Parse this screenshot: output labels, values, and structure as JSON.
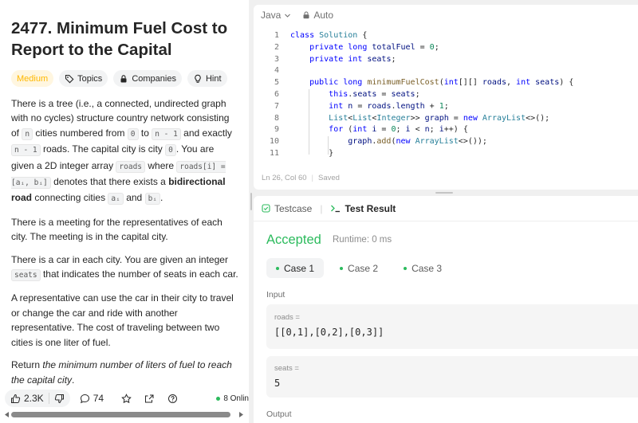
{
  "problem": {
    "title": "2477. Minimum Fuel Cost to Report to the Capital",
    "tags": {
      "difficulty": "Medium",
      "topics": "Topics",
      "companies": "Companies",
      "hint": "Hint"
    },
    "p1": {
      "t1": "There is a tree (i.e., a connected, undirected graph with no cycles) structure country network consisting of ",
      "c1": "n",
      "t2": " cities numbered from ",
      "c2": "0",
      "t3": " to ",
      "c3": "n - 1",
      "t4": " and exactly ",
      "c4": "n - 1",
      "t5": " roads. The capital city is city ",
      "c5": "0",
      "t6": ". You are given a 2D integer array ",
      "c6": "roads",
      "t7": " where ",
      "c7": "roads[i] = [aᵢ, bᵢ]",
      "t8": " denotes that there exists a ",
      "b1": "bidirectional road",
      "t9": " connecting cities ",
      "c8": "aᵢ",
      "t10": " and ",
      "c9": "bᵢ",
      "t11": "."
    },
    "p2": "There is a meeting for the representatives of each city. The meeting is in the capital city.",
    "p3": {
      "t1": "There is a car in each city. You are given an integer ",
      "c1": "seats",
      "t2": " that indicates the number of seats in each car."
    },
    "p4": "A representative can use the car in their city to travel or change the car and ride with another representative. The cost of traveling between two cities is one liter of fuel.",
    "p5": {
      "t1": "Return ",
      "i1": "the minimum number of liters of fuel to reach the capital city",
      "t2": "."
    },
    "bottom": {
      "likes": "2.3K",
      "comments": "74",
      "online": "8 Onlin"
    }
  },
  "editor": {
    "language": "Java",
    "mode": "Auto",
    "status": {
      "position": "Ln 26, Col 60",
      "saved": "Saved"
    },
    "line_numbers": [
      "1",
      "2",
      "3",
      "4",
      "5",
      "6",
      "7",
      "8",
      "9",
      "10",
      "11"
    ]
  },
  "results": {
    "tabs": {
      "testcase": "Testcase",
      "test_result": "Test Result"
    },
    "status": "Accepted",
    "runtime": "Runtime: 0 ms",
    "cases": [
      "Case 1",
      "Case 2",
      "Case 3"
    ],
    "input_label": "Input",
    "roads_label": "roads =",
    "roads_value": "[[0,1],[0,2],[0,3]]",
    "seats_label": "seats =",
    "seats_value": "5",
    "output_label": "Output"
  },
  "colors": {
    "accepted": "#2cbb5d",
    "medium": "#ffb800",
    "keyword": "#0000ff",
    "type": "#267f99",
    "number": "#098658"
  }
}
